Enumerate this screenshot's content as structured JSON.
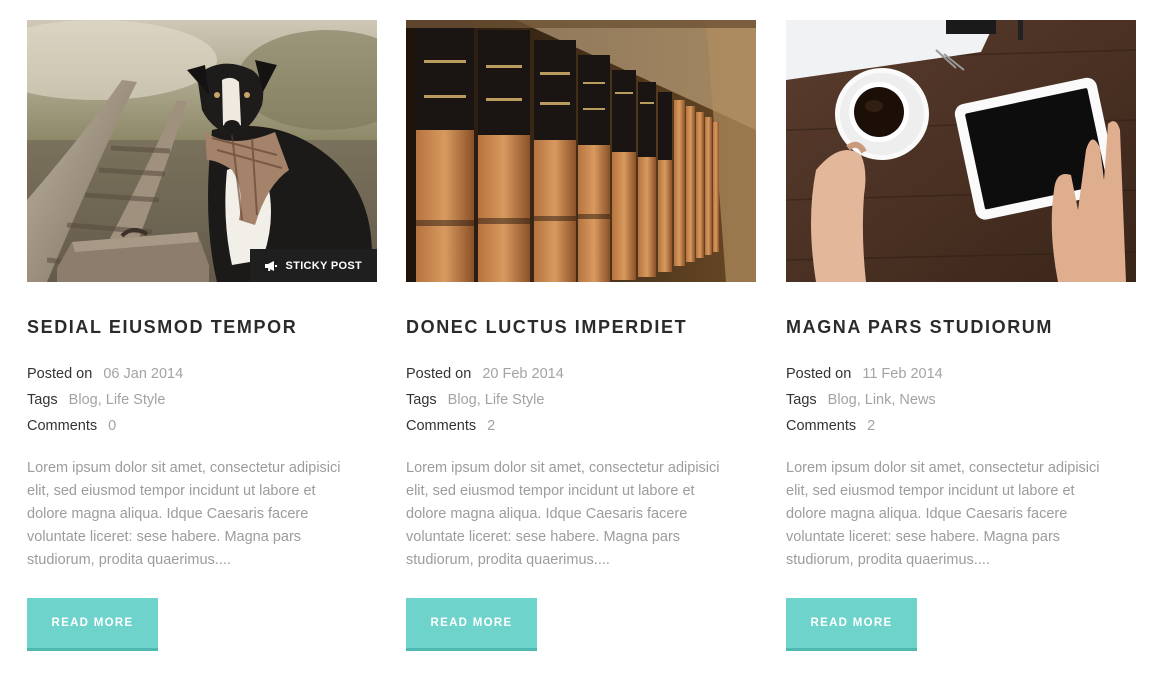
{
  "posts": [
    {
      "image": "dog-with-scarf-on-railway",
      "badge": {
        "icon": "megaphone-icon",
        "label": "STICKY POST"
      },
      "title": "SEDIAL EIUSMOD TEMPOR",
      "posted_label": "Posted on",
      "posted_value": "06 Jan 2014",
      "tags_label": "Tags",
      "tags": [
        "Blog",
        "Life Style"
      ],
      "tags_text": "Blog, Life Style",
      "comments_label": "Comments",
      "comments_value": "0",
      "excerpt": "Lorem ipsum dolor sit amet, consectetur adipisici elit, sed eiusmod tempor incidunt ut labore et dolore magna aliqua. Idque Caesaris facere voluntate liceret: sese habere. Magna pars studiorum, prodita quaerimus....",
      "button": "READ MORE"
    },
    {
      "image": "law-books-on-shelf",
      "title": "DONEC LUCTUS IMPERDIET",
      "posted_label": "Posted on",
      "posted_value": "20 Feb 2014",
      "tags_label": "Tags",
      "tags": [
        "Blog",
        "Life Style"
      ],
      "tags_text": "Blog, Life Style",
      "comments_label": "Comments",
      "comments_value": "2",
      "excerpt": "Lorem ipsum dolor sit amet, consectetur adipisici elit, sed eiusmod tempor incidunt ut labore et dolore magna aliqua. Idque Caesaris facere voluntate liceret: sese habere. Magna pars studiorum, prodita quaerimus....",
      "button": "READ MORE"
    },
    {
      "image": "coffee-and-tablet-on-desk",
      "title": "MAGNA PARS STUDIORUM",
      "posted_label": "Posted on",
      "posted_value": "11 Feb 2014",
      "tags_label": "Tags",
      "tags": [
        "Blog",
        "Link",
        "News"
      ],
      "tags_text": "Blog, Link, News",
      "comments_label": "Comments",
      "comments_value": "2",
      "excerpt": "Lorem ipsum dolor sit amet, consectetur adipisici elit, sed eiusmod tempor incidunt ut labore et dolore magna aliqua. Idque Caesaris facere voluntate liceret: sese habere. Magna pars studiorum, prodita quaerimus....",
      "button": "READ MORE"
    }
  ],
  "colors": {
    "accent": "#6dd3cb",
    "accent_dark": "#4fb9b1",
    "heading": "#2b2b2b",
    "muted": "#a3a3a3",
    "badge_bg": "#1f1f1f"
  }
}
